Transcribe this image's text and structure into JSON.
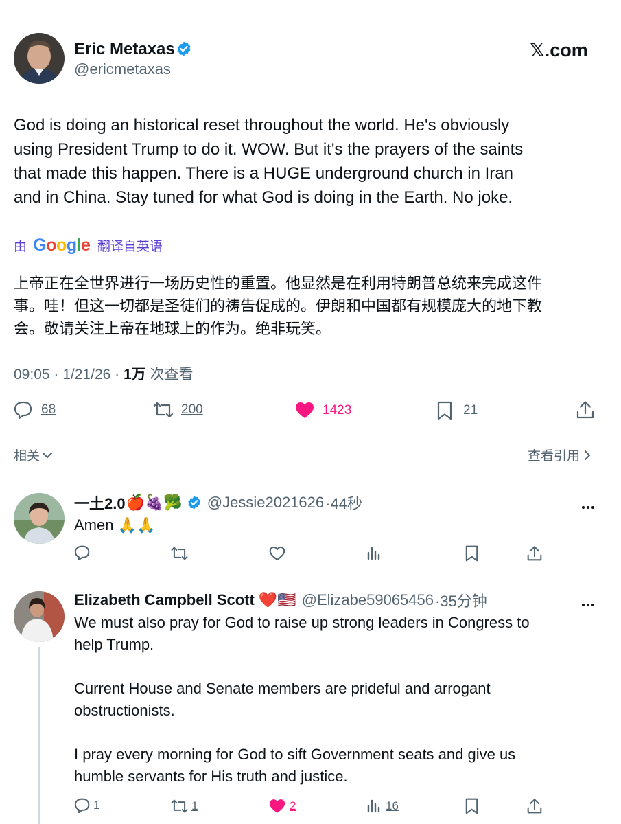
{
  "header": {
    "display_name": "Eric Metaxas",
    "handle": "@ericmetaxas",
    "site_logo_text": "𝕏.com"
  },
  "post": {
    "text_lines": [
      "God is doing an historical reset throughout the world. He's obviously",
      "using President Trump to do it. WOW. But it's the prayers of the saints",
      "that made this happen. There is a HUGE underground church in Iran",
      "and in China. Stay tuned for what God is doing in the Earth. No joke."
    ],
    "translation_prefix": "由",
    "translation_brand": "Google",
    "translation_suffix": "翻译自英语",
    "translated_lines": [
      "上帝正在全世界进行一场历史性的重置。他显然是在利用特朗普总统来完成这件",
      "事。哇！但这一切都是圣徒们的祷告促成的。伊朗和中国都有规模庞大的地下教",
      "会。敬请关注上帝在地球上的作为。绝非玩笑。"
    ],
    "time": "09:05",
    "sep1": " · ",
    "date": "1/21/26",
    "sep2": " · ",
    "views_count": "1万",
    "views_label": " 次查看",
    "stats": {
      "replies": "68",
      "reposts": "200",
      "likes": "1423",
      "bookmarks": "21"
    },
    "related_label": "相关",
    "quotes_label": "查看引用"
  },
  "replies": [
    {
      "display_name": "一土2.0",
      "emojis": "🍎🍇🥦",
      "handle": "@Jessie2021626",
      "time": "·44秒",
      "text_lines": [
        "Amen 🙏🙏"
      ],
      "stats": {
        "replies": "",
        "reposts": "",
        "likes": "",
        "views": ""
      }
    },
    {
      "display_name": "Elizabeth Campbell Scott",
      "emojis": "❤️🇺🇸",
      "handle": "@Elizabe59065456",
      "time": "·35分钟",
      "text_lines": [
        "We must also pray for God to raise up strong leaders in Congress to",
        "help Trump.",
        "",
        "Current House and Senate members are prideful and arrogant",
        "obstructionists.",
        "",
        "I pray every morning for God to sift Government seats and give us",
        "humble servants for His truth and justice."
      ],
      "stats": {
        "replies": "1",
        "reposts": "1",
        "likes": "2",
        "views": "16"
      }
    }
  ],
  "colors": {
    "like_pink": "#f91880",
    "verified_blue": "#1d9bf0",
    "muted_gray": "#536471",
    "google_blue": "#4285f4",
    "google_red": "#ea4335",
    "google_yellow": "#fbbc05",
    "google_green": "#34a853",
    "translate_purple": "#5b3fd6"
  }
}
